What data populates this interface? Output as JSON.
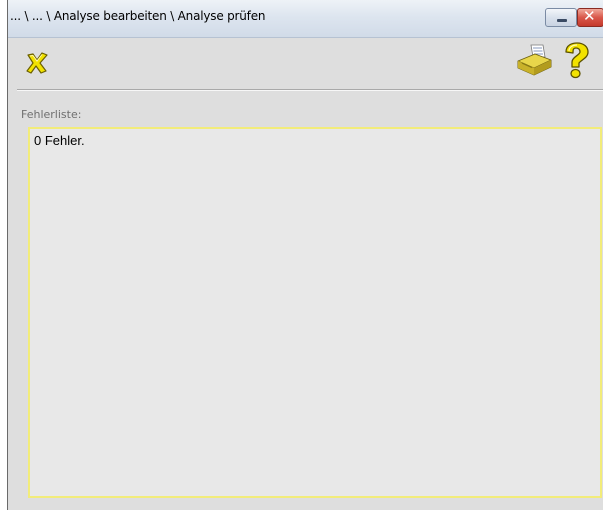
{
  "window": {
    "title": "... \\ ... \\ Analyse bearbeiten \\ Analyse prüfen"
  },
  "toolbar": {
    "buttons": [
      {
        "id": "cancel",
        "icon": "x-cancel-icon",
        "color": "#f2e200"
      },
      {
        "id": "print",
        "icon": "printer-icon",
        "color": "#e8d64a"
      },
      {
        "id": "help",
        "icon": "question-mark-icon",
        "color": "#f2e200"
      }
    ]
  },
  "error_list": {
    "label": "Fehlerliste:",
    "text": "0 Fehler."
  },
  "colors": {
    "accent_yellow": "#f2e200",
    "list_border": "#f2ec7a",
    "close_button": "#c4392c"
  }
}
